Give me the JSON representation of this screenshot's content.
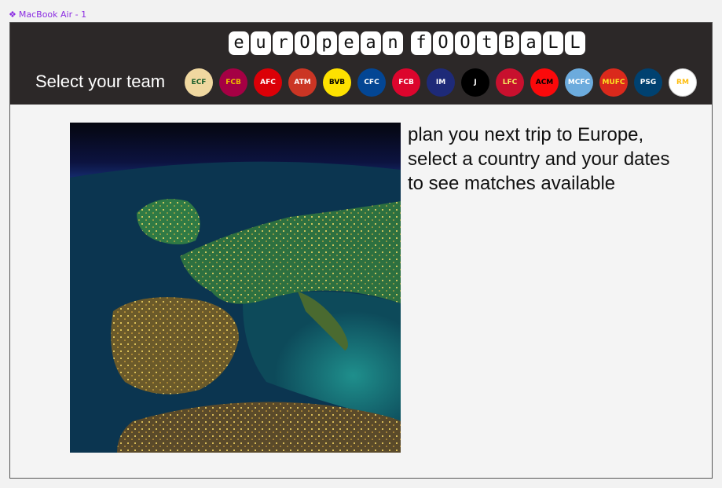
{
  "frame": {
    "label": "MacBook Air - 1",
    "icon": "component-diamond-icon"
  },
  "header": {
    "title_words": [
      "EUROPEAN",
      "FOOTBALL"
    ],
    "title_display": [
      "eurOpean",
      "fOOtBaLL"
    ],
    "select_label": "Select your team",
    "teams": [
      {
        "name": "Elche",
        "icon": "elche-crest-icon",
        "bg": "#f0d8a0",
        "fg": "#1a5e2a",
        "abbr": "ECF"
      },
      {
        "name": "FC Barcelona",
        "icon": "barcelona-crest-icon",
        "bg": "#a50044",
        "fg": "#edbb00",
        "abbr": "FCB"
      },
      {
        "name": "Arsenal",
        "icon": "arsenal-crest-icon",
        "bg": "#db0007",
        "fg": "#ffffff",
        "abbr": "AFC"
      },
      {
        "name": "Atletico Madrid",
        "icon": "atletico-crest-icon",
        "bg": "#cb3524",
        "fg": "#ffffff",
        "abbr": "ATM"
      },
      {
        "name": "Borussia Dortmund",
        "icon": "dortmund-crest-icon",
        "bg": "#fde100",
        "fg": "#000000",
        "abbr": "BVB"
      },
      {
        "name": "Chelsea",
        "icon": "chelsea-crest-icon",
        "bg": "#034694",
        "fg": "#ffffff",
        "abbr": "CFC"
      },
      {
        "name": "Bayern Munich",
        "icon": "bayern-crest-icon",
        "bg": "#dc052d",
        "fg": "#ffffff",
        "abbr": "FCB"
      },
      {
        "name": "Inter",
        "icon": "inter-crest-icon",
        "bg": "#1e2a78",
        "fg": "#ffffff",
        "abbr": "IM"
      },
      {
        "name": "Juventus",
        "icon": "juventus-crest-icon",
        "bg": "#000000",
        "fg": "#ffffff",
        "abbr": "J"
      },
      {
        "name": "Liverpool",
        "icon": "liverpool-crest-icon",
        "bg": "#c8102e",
        "fg": "#f6eb61",
        "abbr": "LFC"
      },
      {
        "name": "AC Milan",
        "icon": "milan-crest-icon",
        "bg": "#fb090b",
        "fg": "#000000",
        "abbr": "ACM"
      },
      {
        "name": "Manchester City",
        "icon": "mancity-crest-icon",
        "bg": "#6cabdd",
        "fg": "#ffffff",
        "abbr": "MCFC"
      },
      {
        "name": "Manchester United",
        "icon": "manutd-crest-icon",
        "bg": "#da291c",
        "fg": "#fbe122",
        "abbr": "MUFC"
      },
      {
        "name": "Paris Saint-Germain",
        "icon": "psg-crest-icon",
        "bg": "#004170",
        "fg": "#ffffff",
        "abbr": "PSG"
      },
      {
        "name": "Real Madrid",
        "icon": "realmadrid-crest-icon",
        "bg": "#ffffff",
        "fg": "#febe10",
        "abbr": "RM"
      }
    ]
  },
  "main": {
    "image": "europe-at-night-satellite-image",
    "blurb": "plan you next trip to Europe, select a country and your dates to see matches available"
  },
  "colors": {
    "header_bg": "#2c2828",
    "page_bg": "#f4f4f4",
    "frame_label": "#8b2be2"
  }
}
